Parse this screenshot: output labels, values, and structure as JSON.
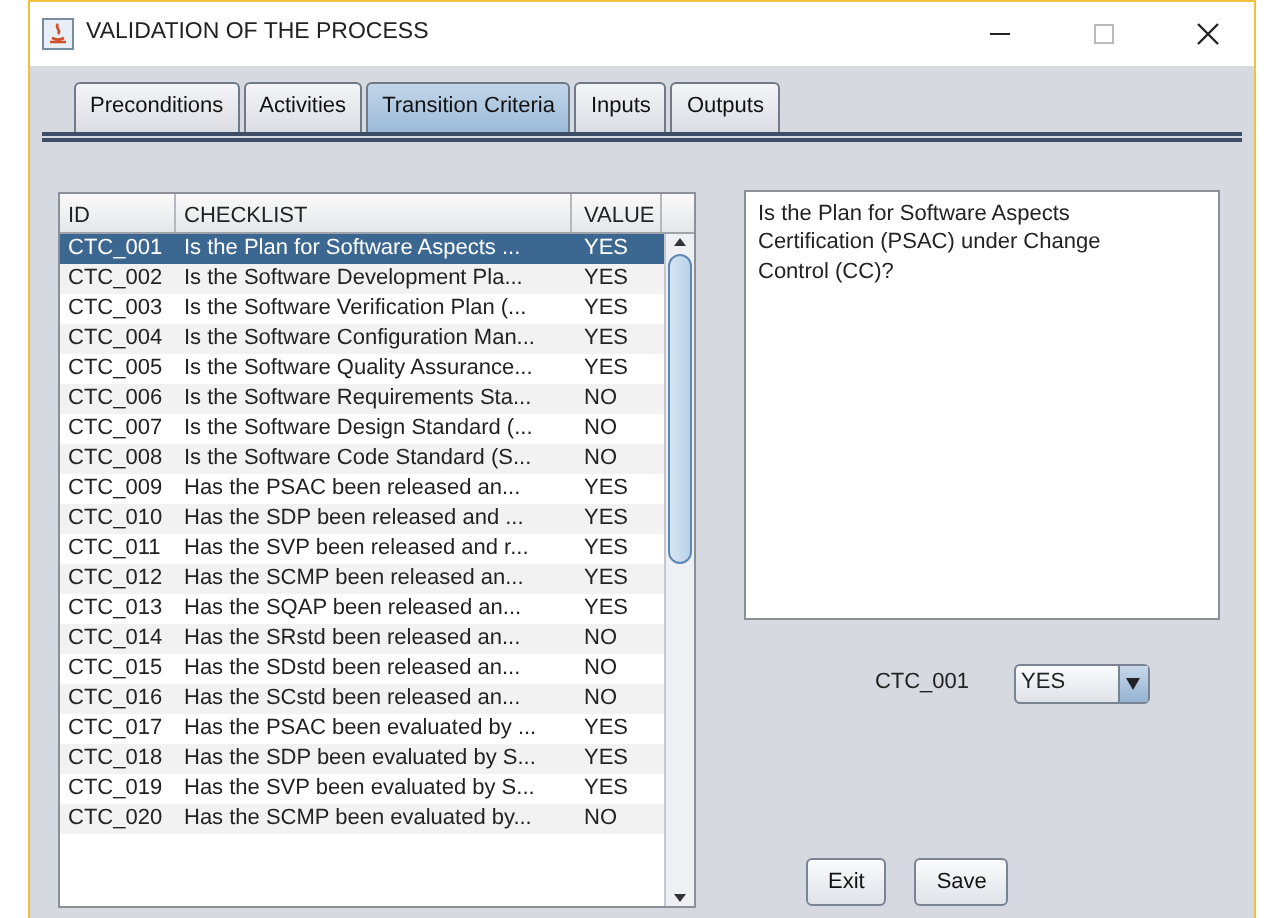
{
  "window": {
    "title": "VALIDATION OF THE PROCESS"
  },
  "tabs": [
    {
      "label": "Preconditions",
      "selected": false
    },
    {
      "label": "Activities",
      "selected": false
    },
    {
      "label": "Transition Criteria",
      "selected": true
    },
    {
      "label": "Inputs",
      "selected": false
    },
    {
      "label": "Outputs",
      "selected": false
    }
  ],
  "table": {
    "columns": [
      "ID",
      "CHECKLIST",
      "VALUE"
    ],
    "rows": [
      {
        "id": "CTC_001",
        "checklist": "Is the Plan for Software Aspects ...",
        "value": "YES",
        "selected": true
      },
      {
        "id": "CTC_002",
        "checklist": "Is the Software Development Pla...",
        "value": "YES",
        "selected": false
      },
      {
        "id": "CTC_003",
        "checklist": "Is the Software Verification Plan (...",
        "value": "YES",
        "selected": false
      },
      {
        "id": "CTC_004",
        "checklist": "Is the Software Configuration Man...",
        "value": "YES",
        "selected": false
      },
      {
        "id": "CTC_005",
        "checklist": "Is the Software Quality Assurance...",
        "value": "YES",
        "selected": false
      },
      {
        "id": "CTC_006",
        "checklist": "Is the Software Requirements Sta...",
        "value": "NO",
        "selected": false
      },
      {
        "id": "CTC_007",
        "checklist": "Is the Software Design Standard (...",
        "value": "NO",
        "selected": false
      },
      {
        "id": "CTC_008",
        "checklist": "Is the Software Code Standard (S...",
        "value": "NO",
        "selected": false
      },
      {
        "id": "CTC_009",
        "checklist": "Has the PSAC been released an...",
        "value": "YES",
        "selected": false
      },
      {
        "id": "CTC_010",
        "checklist": "Has the SDP been released and ...",
        "value": "YES",
        "selected": false
      },
      {
        "id": "CTC_011",
        "checklist": "Has the SVP been released and r...",
        "value": "YES",
        "selected": false
      },
      {
        "id": "CTC_012",
        "checklist": "Has the SCMP been released an...",
        "value": "YES",
        "selected": false
      },
      {
        "id": "CTC_013",
        "checklist": "Has the SQAP been released an...",
        "value": "YES",
        "selected": false
      },
      {
        "id": "CTC_014",
        "checklist": "Has the SRstd been released an...",
        "value": "NO",
        "selected": false
      },
      {
        "id": "CTC_015",
        "checklist": "Has the SDstd been released an...",
        "value": "NO",
        "selected": false
      },
      {
        "id": "CTC_016",
        "checklist": "Has the SCstd been released an...",
        "value": "NO",
        "selected": false
      },
      {
        "id": "CTC_017",
        "checklist": "Has the PSAC been evaluated by ...",
        "value": "YES",
        "selected": false
      },
      {
        "id": "CTC_018",
        "checklist": "Has the SDP been evaluated by S...",
        "value": "YES",
        "selected": false
      },
      {
        "id": "CTC_019",
        "checklist": "Has the SVP been evaluated by S...",
        "value": "YES",
        "selected": false
      },
      {
        "id": "CTC_020",
        "checklist": "Has the SCMP been evaluated by...",
        "value": "NO",
        "selected": false
      }
    ]
  },
  "detail": {
    "text": "Is the Plan for Software Aspects Certification (PSAC) under Change Control (CC)?",
    "id": "CTC_001",
    "value": "YES"
  },
  "buttons": [
    "Exit",
    "Save"
  ]
}
